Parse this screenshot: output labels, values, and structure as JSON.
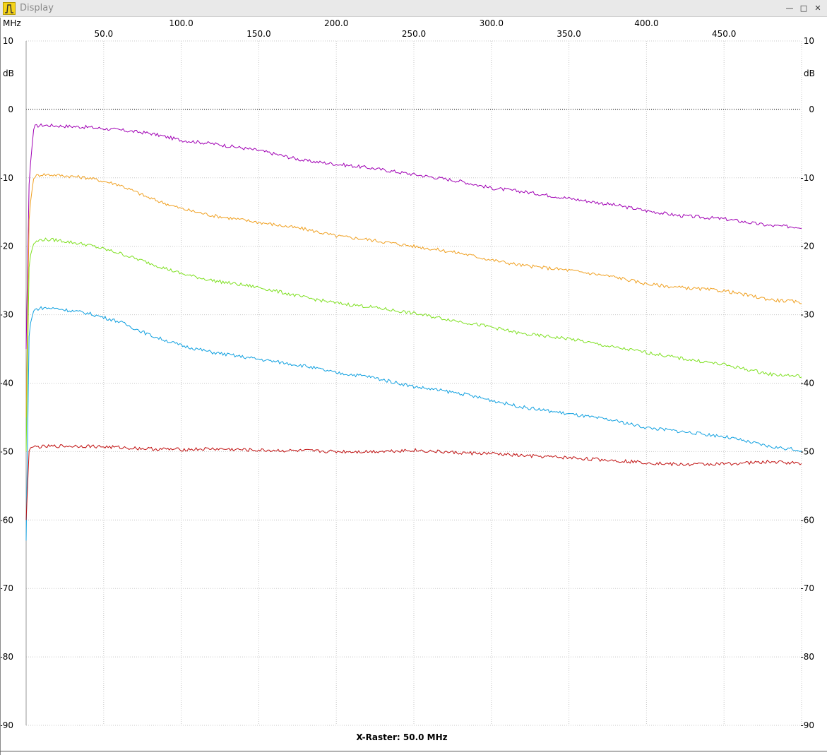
{
  "window": {
    "title": "Display",
    "icon": "filter-icon",
    "buttons": [
      "minimize-icon",
      "maximize-icon",
      "close-icon"
    ]
  },
  "x_unit_label": "MHz",
  "y_unit_label": "dB",
  "footer": "X-Raster: 50.0 MHz",
  "chart_data": {
    "type": "line",
    "xlabel": "MHz",
    "ylabel": "dB",
    "xlim": [
      0,
      500
    ],
    "ylim": [
      -90,
      10
    ],
    "grid": true,
    "reference_line": 0,
    "x_ticks_upper": [
      "100.0",
      "200.0",
      "300.0",
      "400.0"
    ],
    "x_ticks_lower": [
      "50.0",
      "150.0",
      "250.0",
      "350.0",
      "450.0"
    ],
    "y_ticks": [
      "10",
      "0",
      "-10",
      "-20",
      "-30",
      "-40",
      "-50",
      "-60",
      "-70",
      "-80",
      "-90"
    ],
    "series": [
      {
        "color": "#a000b4",
        "x": [
          0,
          2,
          5,
          10,
          20,
          40,
          60,
          80,
          100,
          120,
          150,
          180,
          200,
          220,
          250,
          280,
          300,
          320,
          350,
          380,
          400,
          420,
          450,
          480,
          500
        ],
        "values": [
          -35,
          -10,
          -2.5,
          -2.3,
          -2.4,
          -2.6,
          -3,
          -3.5,
          -4.5,
          -5,
          -6,
          -7.5,
          -8,
          -8.5,
          -9.5,
          -10.5,
          -11.5,
          -12,
          -13,
          -14,
          -14.8,
          -15.5,
          -16,
          -17,
          -17.2
        ]
      },
      {
        "color": "#f0a020",
        "x": [
          0,
          2,
          5,
          10,
          20,
          40,
          60,
          80,
          100,
          120,
          150,
          180,
          200,
          220,
          250,
          280,
          300,
          320,
          350,
          380,
          400,
          420,
          450,
          480,
          500
        ],
        "values": [
          -45,
          -15,
          -9.8,
          -9.5,
          -9.6,
          -10,
          -11,
          -13,
          -14.5,
          -15.5,
          -16.5,
          -17.5,
          -18.5,
          -19,
          -20,
          -21,
          -22,
          -22.8,
          -23.5,
          -24.5,
          -25.5,
          -26,
          -26.5,
          -27.8,
          -28.2
        ]
      },
      {
        "color": "#7ee020",
        "x": [
          0,
          2,
          5,
          10,
          20,
          40,
          60,
          80,
          100,
          120,
          150,
          180,
          200,
          220,
          250,
          280,
          300,
          320,
          350,
          380,
          400,
          420,
          450,
          480,
          500
        ],
        "values": [
          -50,
          -22,
          -19.5,
          -19,
          -19.1,
          -19.8,
          -21,
          -22.5,
          -24,
          -25,
          -26,
          -27.5,
          -28.3,
          -28.8,
          -29.8,
          -31,
          -31.8,
          -32.8,
          -33.5,
          -34.8,
          -35.5,
          -36.3,
          -37.3,
          -38.7,
          -39
        ]
      },
      {
        "color": "#10a0e0",
        "x": [
          0,
          2,
          5,
          10,
          20,
          40,
          60,
          80,
          100,
          120,
          150,
          180,
          200,
          220,
          250,
          280,
          300,
          320,
          350,
          380,
          400,
          420,
          450,
          480,
          500
        ],
        "values": [
          -63,
          -32,
          -29.3,
          -29,
          -29.1,
          -29.8,
          -31,
          -33,
          -34.5,
          -35.5,
          -36.5,
          -37.5,
          -38.5,
          -39,
          -40.5,
          -41.5,
          -42.5,
          -43.5,
          -44.5,
          -45.5,
          -46.5,
          -47,
          -47.8,
          -49.3,
          -49.8
        ]
      },
      {
        "color": "#c01010",
        "x": [
          0,
          2,
          5,
          10,
          20,
          40,
          60,
          80,
          100,
          120,
          150,
          180,
          200,
          220,
          250,
          280,
          300,
          320,
          350,
          380,
          400,
          420,
          450,
          480,
          500
        ],
        "values": [
          -60,
          -49.5,
          -49.3,
          -49.3,
          -49.2,
          -49.2,
          -49.4,
          -49.6,
          -49.7,
          -49.6,
          -49.8,
          -49.9,
          -50,
          -50,
          -49.8,
          -50.2,
          -50.3,
          -50.6,
          -50.9,
          -51.3,
          -51.6,
          -51.9,
          -51.8,
          -51.5,
          -51.7
        ]
      }
    ]
  }
}
